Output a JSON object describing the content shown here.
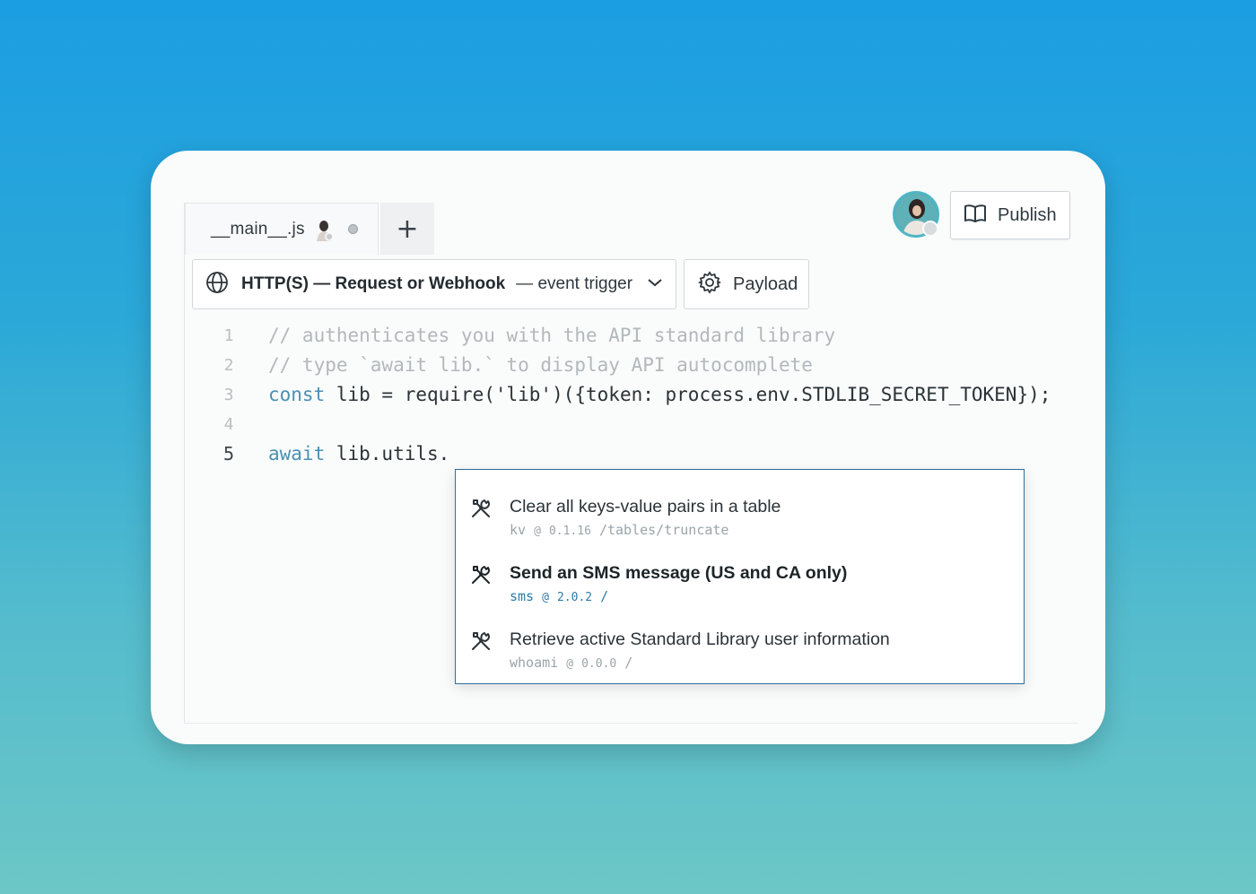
{
  "tabs": {
    "file_name": "__main__.js",
    "add_label": "+"
  },
  "header": {
    "publish_label": "Publish"
  },
  "trigger": {
    "main_label": "HTTP(S) — Request or Webhook",
    "sub_label": "— event trigger"
  },
  "payload": {
    "label": "Payload"
  },
  "code": {
    "lines": [
      {
        "number": "1",
        "comment": "// authenticates you with the API standard library"
      },
      {
        "number": "2",
        "comment": "// type `await lib.` to display API autocomplete"
      },
      {
        "number": "3",
        "keyword": "const",
        "text": " lib = require('lib')({token: process.env.STDLIB_SECRET_TOKEN});"
      },
      {
        "number": "4"
      },
      {
        "number": "5",
        "keyword": "await",
        "text": " lib.utils."
      }
    ]
  },
  "autocomplete": {
    "items": [
      {
        "title": "Clear all keys-value pairs in a table",
        "pkg": "kv",
        "at": "@",
        "version": "0.1.16",
        "path": "/tables/truncate",
        "icon": "tools-icon"
      },
      {
        "title": "Send an SMS message (US and CA only)",
        "pkg": "sms",
        "at": "@",
        "version": "2.0.2",
        "path": "/",
        "icon": "tools-icon"
      },
      {
        "title": "Retrieve active Standard Library user information",
        "pkg": "whoami",
        "at": "@",
        "version": "0.0.0",
        "path": "/",
        "icon": "tools-icon"
      }
    ],
    "selected_index": 1
  },
  "icons": {
    "trigger": "globe-icon",
    "trigger_toggle": "chevron-down-icon",
    "payload": "gear-icon",
    "publish": "book-icon"
  },
  "colors": {
    "accent": "#2d7aa8",
    "keyword": "#4a90b3",
    "comment": "#b3b8bc"
  }
}
